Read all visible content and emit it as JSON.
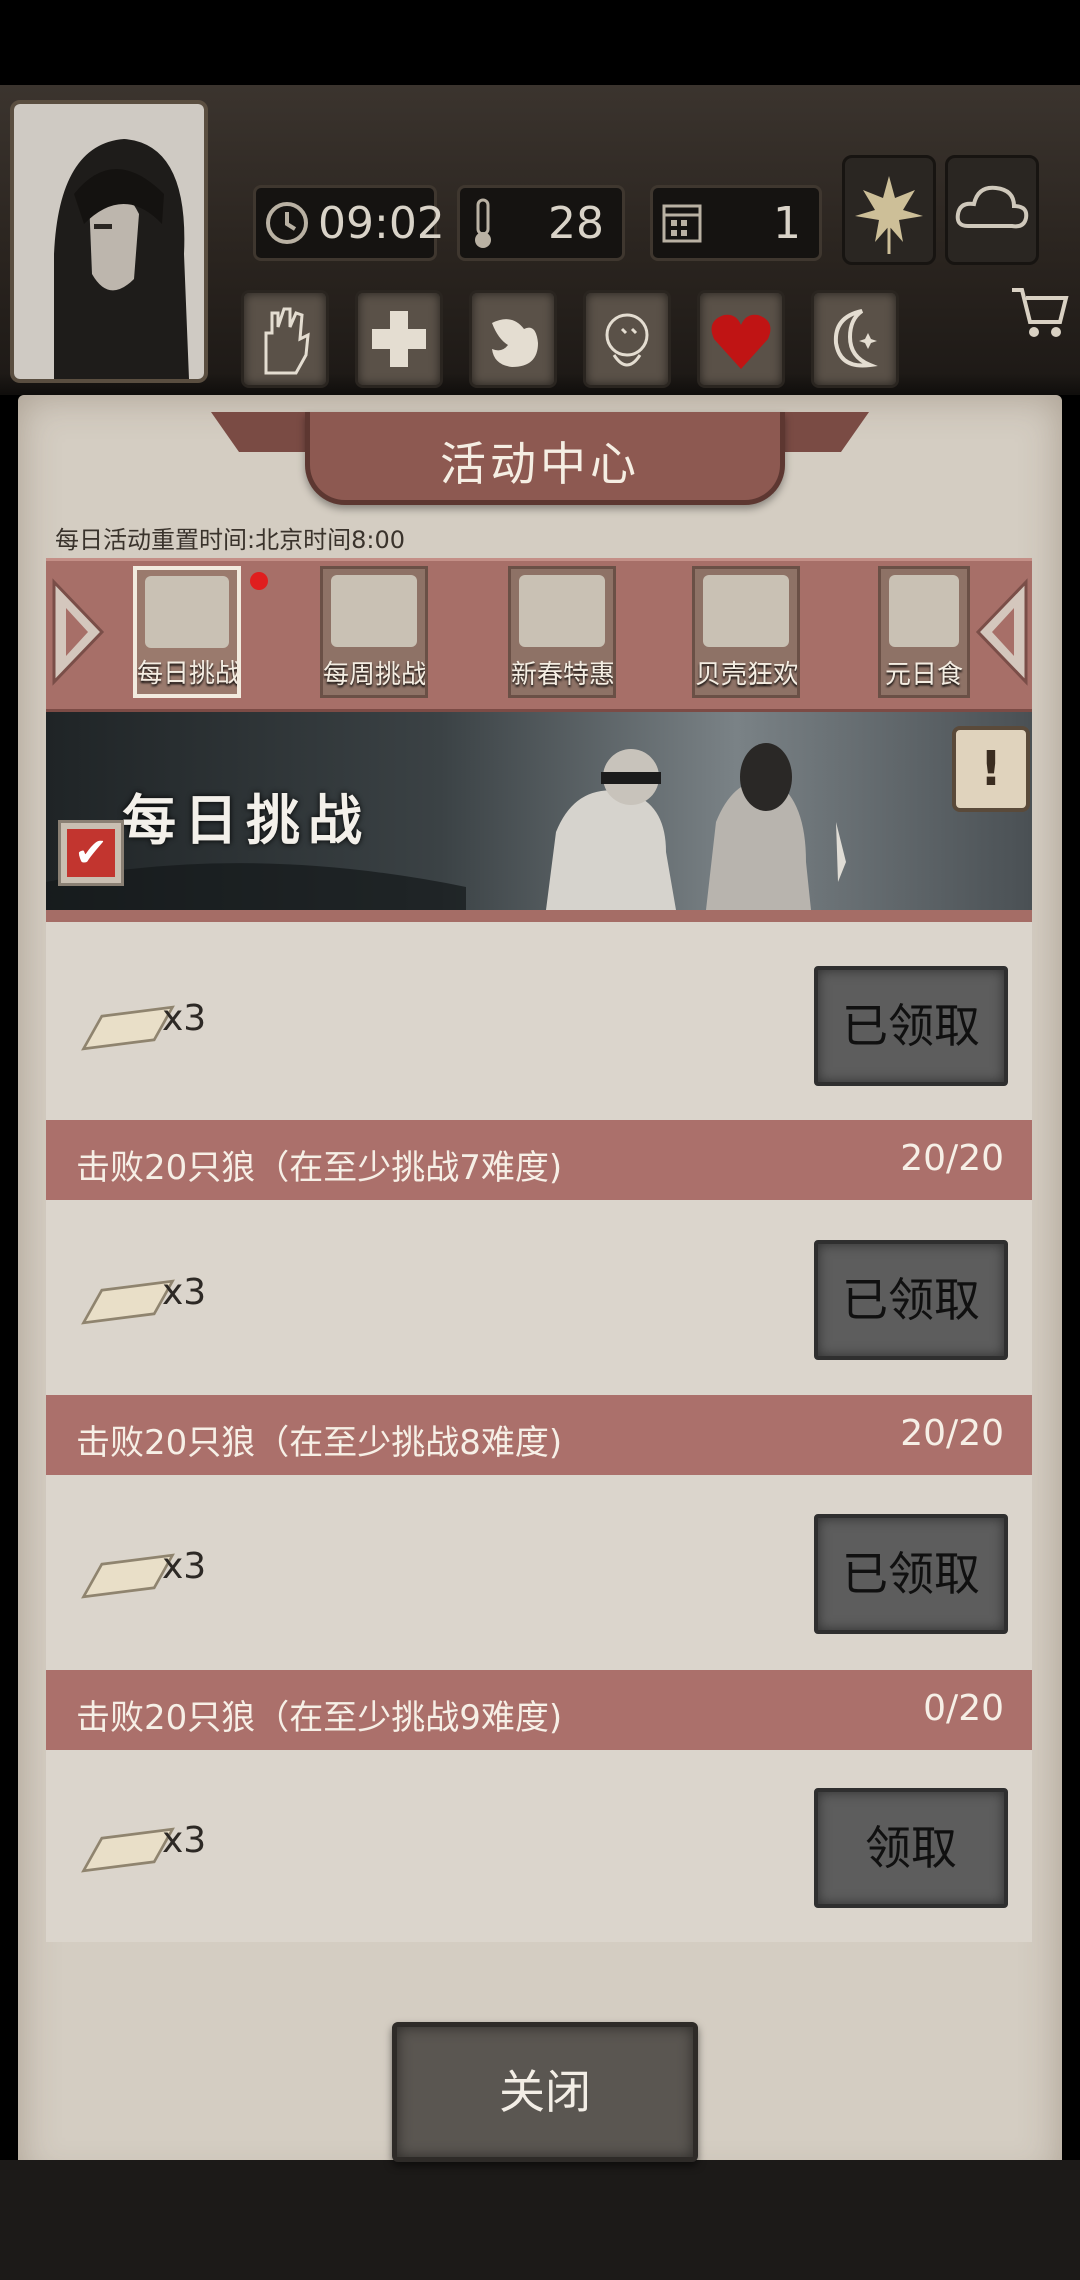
{
  "hud": {
    "time": "09:02",
    "temperature": "28",
    "day": "1",
    "status_icons": [
      "hand-icon",
      "cross-icon",
      "stomach-icon",
      "head-icon",
      "heart-icon",
      "moon-icon"
    ],
    "weather_icons": [
      "leaf-icon",
      "cloud-icon"
    ],
    "shop_icon": "cart-icon"
  },
  "panel": {
    "title": "活动中心",
    "reset_info": "每日活动重置时间:北京时间8:00"
  },
  "tabs": [
    {
      "label": "每日挑战",
      "active": true,
      "has_dot": true
    },
    {
      "label": "每周挑战",
      "active": false
    },
    {
      "label": "新春特惠",
      "active": false
    },
    {
      "label": "贝壳狂欢",
      "active": false
    },
    {
      "label": "元日食",
      "active": false
    }
  ],
  "banner": {
    "title": "每日挑战",
    "info_symbol": "!",
    "checkbox": "checked"
  },
  "rewards": [
    {
      "qty": "x3",
      "button": "已领取"
    },
    {
      "task": "击败20只狼（在至少挑战7难度)",
      "progress": "20/20",
      "qty": "x3",
      "button": "已领取"
    },
    {
      "task": "击败20只狼（在至少挑战8难度)",
      "progress": "20/20",
      "qty": "x3",
      "button": "已领取"
    },
    {
      "task": "击败20只狼（在至少挑战9难度)",
      "progress": "0/20",
      "qty": "x3",
      "button": "领取"
    }
  ],
  "close_label": "关闭",
  "colors": {
    "task_bar": "#ab706b",
    "tab_bar": "#a76f68",
    "panel": "#d4cdc2",
    "button": "#5d5d5d",
    "alert_dot": "#e01e1e"
  }
}
